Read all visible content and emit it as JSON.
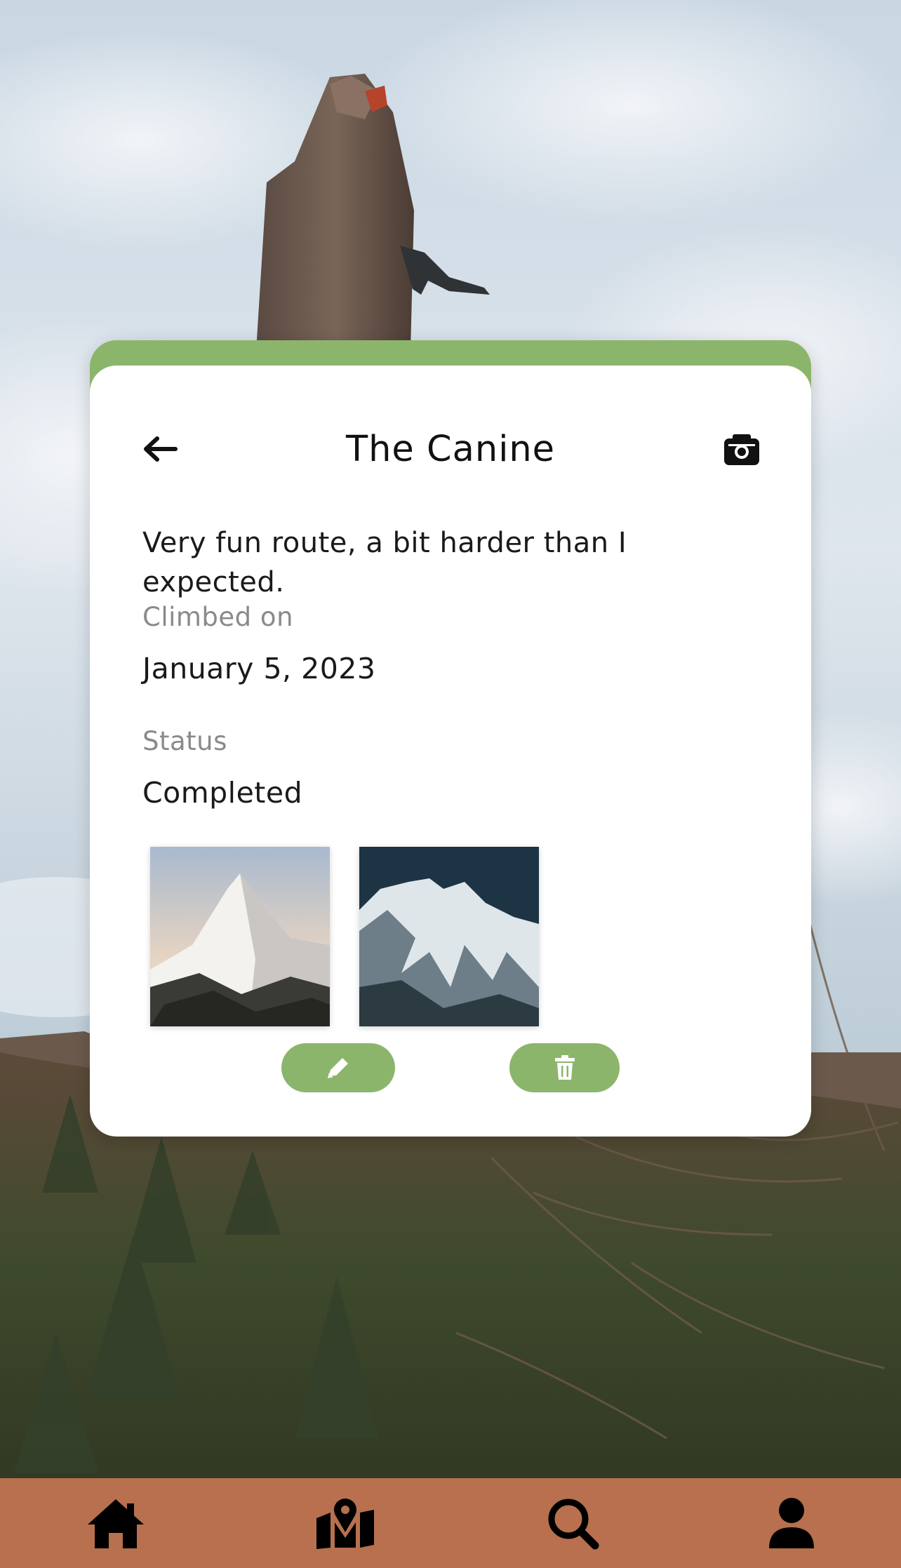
{
  "route": {
    "title": "The Canine",
    "description": "Very fun route, a bit harder than I expected.",
    "climbed_label": "Climbed on",
    "climbed_date": "January 5, 2023",
    "status_label": "Status",
    "status_value": "Completed"
  },
  "photos": [
    {
      "name": "mountain-photo-1"
    },
    {
      "name": "mountain-photo-2"
    }
  ],
  "actions": {
    "edit_icon": "pencil-icon",
    "delete_icon": "trash-icon"
  },
  "icons": {
    "back": "arrow-left-icon",
    "camera": "camera-icon"
  },
  "nav": [
    {
      "icon": "home-icon"
    },
    {
      "icon": "map-pin-icon"
    },
    {
      "icon": "search-icon"
    },
    {
      "icon": "user-icon"
    }
  ],
  "colors": {
    "accent_green": "#8cb56c",
    "nav_bar": "#b8704f",
    "card_bg": "#ffffff"
  }
}
